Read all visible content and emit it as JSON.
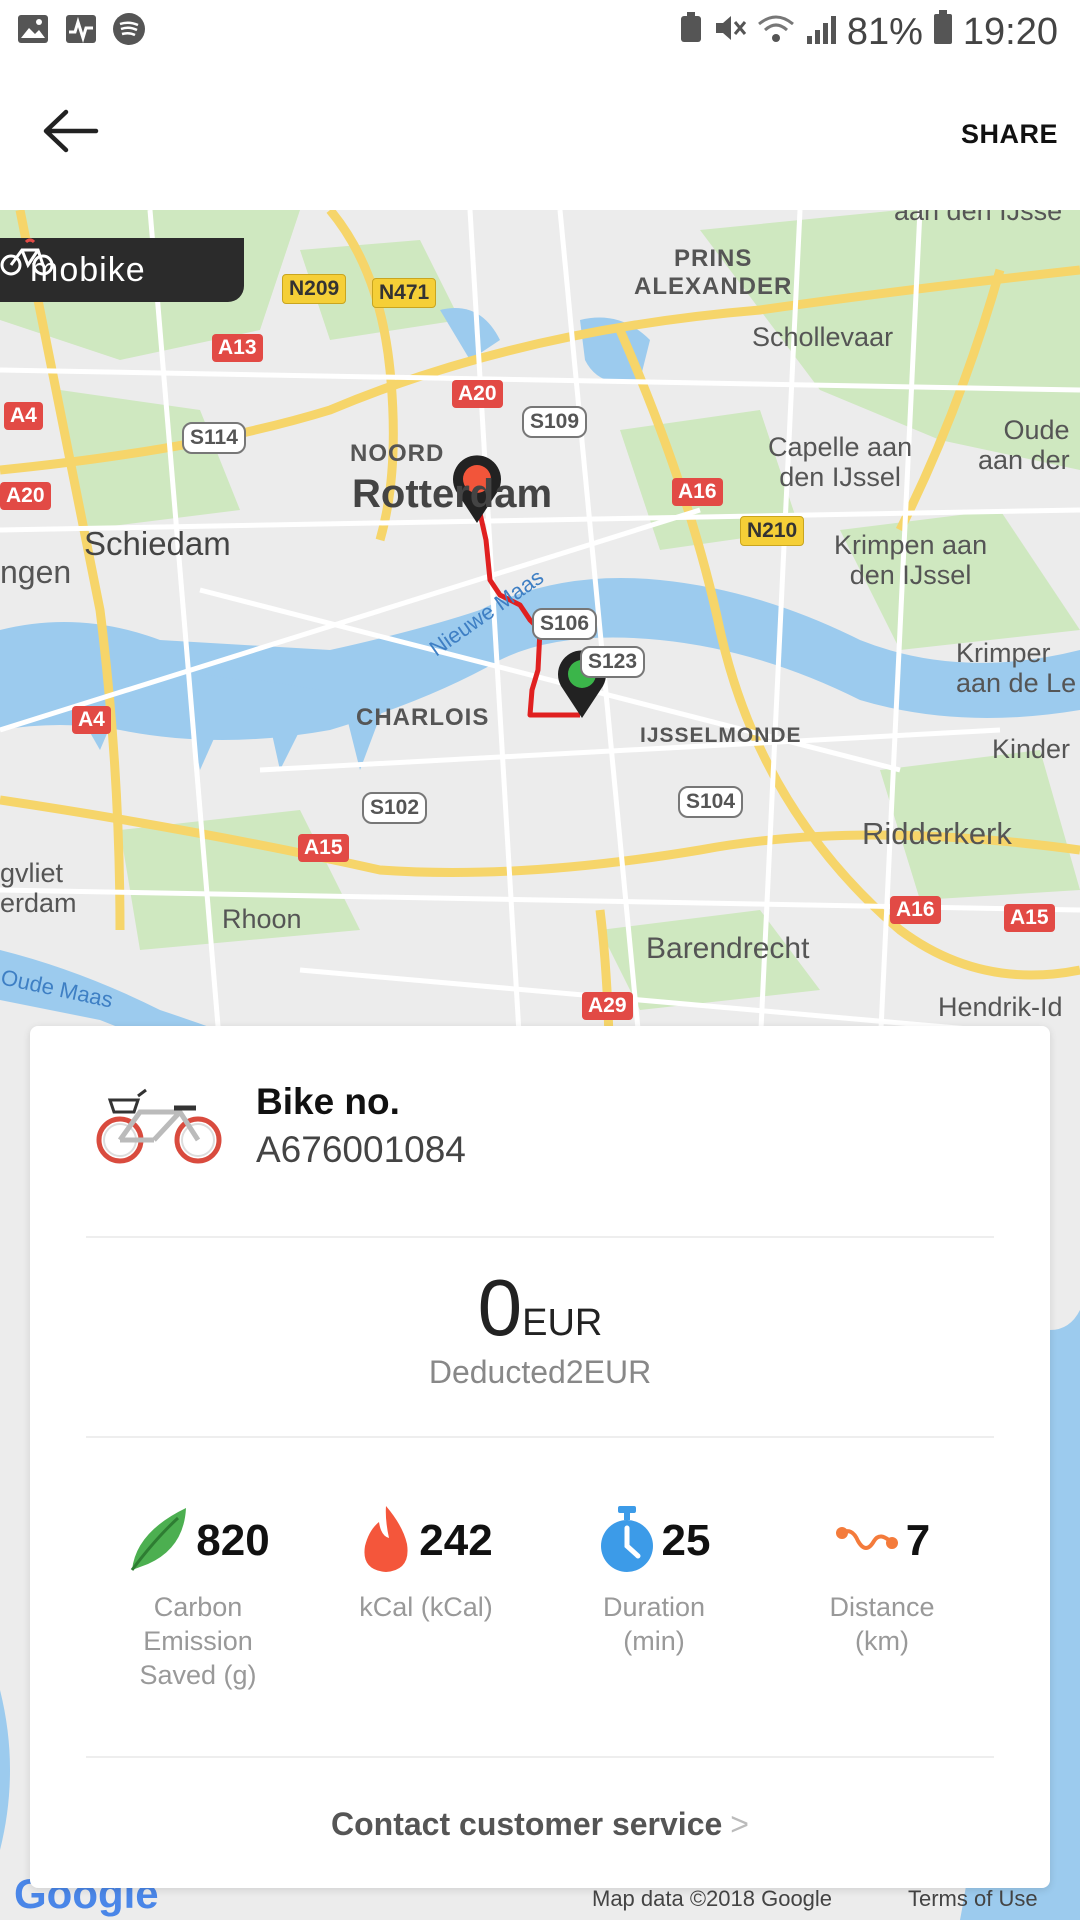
{
  "status_bar": {
    "battery": "81%",
    "time": "19:20"
  },
  "app_bar": {
    "share_label": "SHARE"
  },
  "map": {
    "brand": "mobike",
    "labels": {
      "rotterdam": "Rotterdam",
      "schiedam": "Schiedam",
      "noord": "NOORD",
      "prins_alexander": "PRINS\nALEXANDER",
      "schollevaar": "Schollevaar",
      "capelle": "Capelle aan\nden IJssel",
      "oude": "Oude\naan der",
      "krimpen": "Krimpen aan\nden IJssel",
      "krimpen2": "Krimper\naan de Le",
      "kinder": "Kinder",
      "charlois": "CHARLOIS",
      "ijsselmonde": "IJSSELMONDE",
      "ridderkerk": "Ridderkerk",
      "barendrecht": "Barendrecht",
      "rhoon": "Rhoon",
      "hendrik": "Hendrik-Id",
      "ngen": "ngen",
      "gvliet": "gvliet\nerdam",
      "nieuwe_maas": "Nieuwe Maas",
      "oude_maas": "Oude Maas",
      "aan_den": "aan den IJsse"
    },
    "shields": {
      "n209": "N209",
      "n471": "N471",
      "a13": "A13",
      "a20a": "A20",
      "a20b": "A20",
      "a4a": "A4",
      "s114": "S114",
      "s109": "S109",
      "a16a": "A16",
      "n210": "N210",
      "s106": "S106",
      "s123": "S123",
      "a4b": "A4",
      "s102": "S102",
      "s104": "S104",
      "a15a": "A15",
      "a16b": "A16",
      "a15b": "A15",
      "a29": "A29"
    },
    "attribution": "Map data ©2018 Google",
    "terms": "Terms of Use",
    "google": "Google"
  },
  "ride": {
    "bike_title": "Bike no.",
    "bike_number": "A676001084",
    "fare_amount": "0",
    "fare_currency": "EUR",
    "deducted": "Deducted2EUR",
    "stats": [
      {
        "value": "820",
        "label": "Carbon Emission Saved (g)",
        "icon": "leaf-icon",
        "color": "#4caf50"
      },
      {
        "value": "242",
        "label": "kCal (kCal)",
        "icon": "flame-icon",
        "color": "#f4563b"
      },
      {
        "value": "25",
        "label": "Duration (min)",
        "icon": "stopwatch-icon",
        "color": "#3c9be8"
      },
      {
        "value": "7",
        "label": "Distance (km)",
        "icon": "route-icon",
        "color": "#f47b3b"
      }
    ],
    "contact_label": "Contact customer service"
  }
}
